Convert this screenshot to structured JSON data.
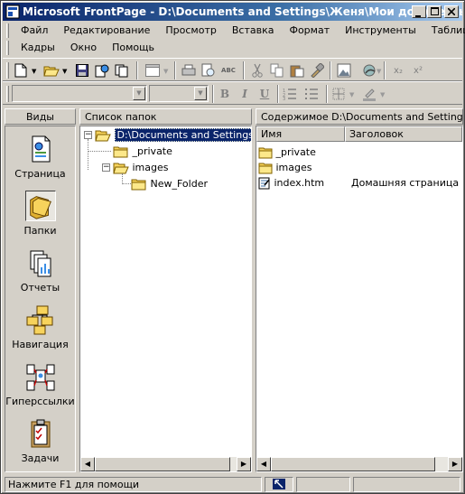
{
  "window": {
    "title": "Microsoft FrontPage - D:\\Documents and Settings\\Женя\\Мои документы\\..."
  },
  "menus": {
    "row1": [
      "Файл",
      "Редактирование",
      "Просмотр",
      "Вставка",
      "Формат",
      "Инструменты",
      "Таблица"
    ],
    "row2": [
      "Кадры",
      "Окно",
      "Помощь"
    ]
  },
  "toolbar": {
    "icons": [
      "new-page-icon",
      "open-icon",
      "save-icon",
      "publish-icon",
      "folder-list-icon",
      "print-icon",
      "print-preview-icon",
      "spelling-icon",
      "cut-icon",
      "copy-icon",
      "paste-icon",
      "format-painter-icon",
      "image-icon",
      "hyperlink-icon",
      "subscript-icon",
      "superscript-icon"
    ],
    "subscript": "x₂",
    "superscript": "x²",
    "spelling_label": "ABC"
  },
  "format_toolbar": {
    "style_value": "",
    "font_value": "",
    "bold": "B",
    "italic": "I",
    "underline": "U"
  },
  "views_pane": {
    "header": "Виды",
    "items": [
      {
        "label": "Страница",
        "icon": "page-icon"
      },
      {
        "label": "Папки",
        "icon": "folders-icon",
        "active": true
      },
      {
        "label": "Отчеты",
        "icon": "reports-icon"
      },
      {
        "label": "Навигация",
        "icon": "navigation-icon"
      },
      {
        "label": "Гиперссылки",
        "icon": "hyperlinks-icon"
      },
      {
        "label": "Задачи",
        "icon": "tasks-icon"
      }
    ]
  },
  "folder_pane": {
    "header": "Список папок",
    "root": "D:\\Documents and Settings\\Женя",
    "children": [
      "_private",
      "images"
    ],
    "grandchildren": [
      "New_Folder"
    ]
  },
  "contents_pane": {
    "header": "Содержимое D:\\Documents and Settings\\Женя",
    "columns": [
      "Имя",
      "Заголовок"
    ],
    "rows": [
      {
        "name": "_private",
        "title": "",
        "icon": "folder-icon"
      },
      {
        "name": "images",
        "title": "",
        "icon": "folder-icon"
      },
      {
        "name": "index.htm",
        "title": "Домашняя страница",
        "icon": "html-file-icon"
      }
    ]
  },
  "status": {
    "text": "Нажмите F1 для помощи"
  },
  "colors": {
    "title_gradient_start": "#0a246a",
    "title_gradient_end": "#a6caf0",
    "selection": "#0a246a",
    "chrome": "#d4d0c8",
    "folder_yellow": "#f7d35c"
  }
}
